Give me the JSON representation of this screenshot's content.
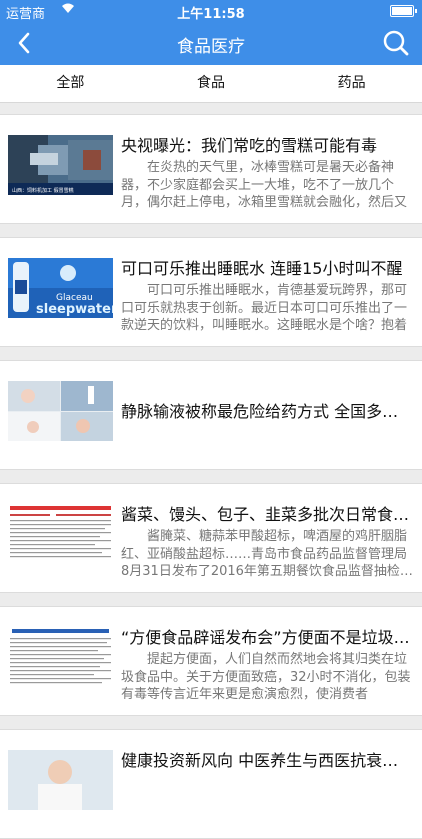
{
  "status": {
    "carrier": "运营商",
    "time": "上午11:58"
  },
  "nav": {
    "title": "食品医疗"
  },
  "tabs": [
    "全部",
    "食品",
    "药品"
  ],
  "articles": [
    {
      "title": "央视曝光：我们常吃的雪糕可能有毒",
      "desc": "在炎热的天气里，冰棒雪糕可是暑天必备神器，不少家庭都会买上一大堆，吃不了一放几个月，偶尔赶上停电，冰箱里雪糕就会融化，然后又被冻…",
      "thumb_caption": "山西：饲料机加工 假冒雪糕"
    },
    {
      "title": "可口可乐推出睡眠水 连睡15小时叫不醒",
      "desc": "可口可乐推出睡眠水，肯德基爱玩跨界，那可口可乐就热衷于创新。最近日本可口可乐推出了一款逆天的饮料，叫睡眠水。这睡眠水是个啥？抱着十…",
      "thumb_brand": "Glaceau",
      "thumb_product": "sleepwater"
    },
    {
      "title": "静脉输液被称最危险给药方式 全国多…",
      "desc": ""
    },
    {
      "title": "酱菜、馒头、包子、韭菜多批次日常食…",
      "desc": "酱腌菜、糖蒜苯甲酸超标，啤酒屋的鸡肝胭脂红、亚硝酸盐超标……青岛市食品药品监督管理局8月31日发布了2016年第五期餐饮食品监督抽检…"
    },
    {
      "title": "“方便食品辟谣发布会”方便面不是垃圾…",
      "desc": "提起方便面，人们自然而然地会将其归类在垃圾食品中。关于方便面致癌，32小时不消化，包装有毒等传言近年来更是愈演愈烈，使消费者闻“面”…"
    },
    {
      "title": "健康投资新风向 中医养生与西医抗衰…",
      "desc": ""
    }
  ],
  "colors": {
    "primary": "#3e8ee8"
  }
}
